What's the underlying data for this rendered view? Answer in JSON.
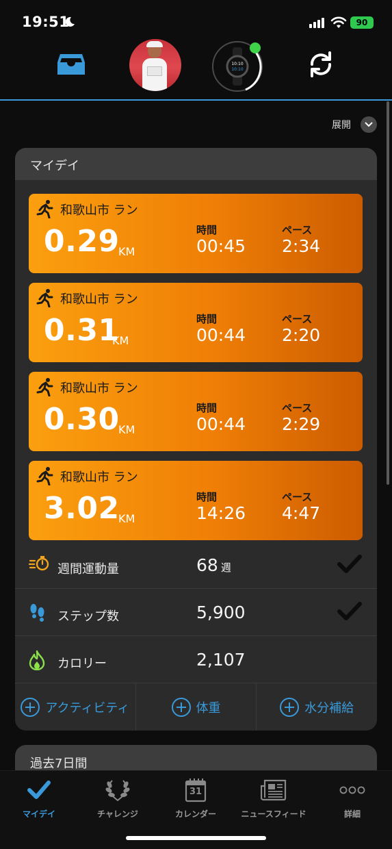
{
  "status_bar": {
    "time": "19:51",
    "battery": "90"
  },
  "top_nav": {
    "icons": [
      "inbox-icon",
      "profile-avatar",
      "watch-icon",
      "sync-icon"
    ],
    "watch_face_time": "10:10"
  },
  "expand_label": "展開",
  "my_day": {
    "title": "マイデイ",
    "activities": [
      {
        "name": "和歌山市 ラン",
        "distance": "0.29",
        "unit": "KM",
        "time_label": "時間",
        "time": "00:45",
        "pace_label": "ペース",
        "pace": "2:34"
      },
      {
        "name": "和歌山市 ラン",
        "distance": "0.31",
        "unit": "KM",
        "time_label": "時間",
        "time": "00:44",
        "pace_label": "ペース",
        "pace": "2:20"
      },
      {
        "name": "和歌山市 ラン",
        "distance": "0.30",
        "unit": "KM",
        "time_label": "時間",
        "time": "00:44",
        "pace_label": "ペース",
        "pace": "2:29"
      },
      {
        "name": "和歌山市 ラン",
        "distance": "3.02",
        "unit": "KM",
        "time_label": "時間",
        "time": "14:26",
        "pace_label": "ペース",
        "pace": "4:47"
      }
    ],
    "stats": [
      {
        "label": "週間運動量",
        "value": "68",
        "unit": "週",
        "icon": "stopwatch-icon",
        "checked": true
      },
      {
        "label": "ステップ数",
        "value": "5,900",
        "unit": "",
        "icon": "footprints-icon",
        "checked": true
      },
      {
        "label": "カロリー",
        "value": "2,107",
        "unit": "",
        "icon": "flame-icon",
        "checked": false
      }
    ],
    "add_buttons": [
      "アクティビティ",
      "体重",
      "水分補給"
    ]
  },
  "last_7_days": {
    "title": "過去7日間"
  },
  "tab_bar": {
    "tabs": [
      {
        "label": "マイデイ",
        "icon": "check-icon",
        "active": true
      },
      {
        "label": "チャレンジ",
        "icon": "laurel-icon",
        "active": false
      },
      {
        "label": "カレンダー",
        "icon": "calendar-icon",
        "active": false,
        "calendar_day": "31"
      },
      {
        "label": "ニュースフィード",
        "icon": "newspaper-icon",
        "active": false
      },
      {
        "label": "詳細",
        "icon": "more-icon",
        "active": false
      }
    ]
  },
  "colors": {
    "accent": "#3a9ad9",
    "activity_orange": "#f28a0a",
    "card_bg": "#2b2b2b",
    "battery_green": "#30c950"
  }
}
